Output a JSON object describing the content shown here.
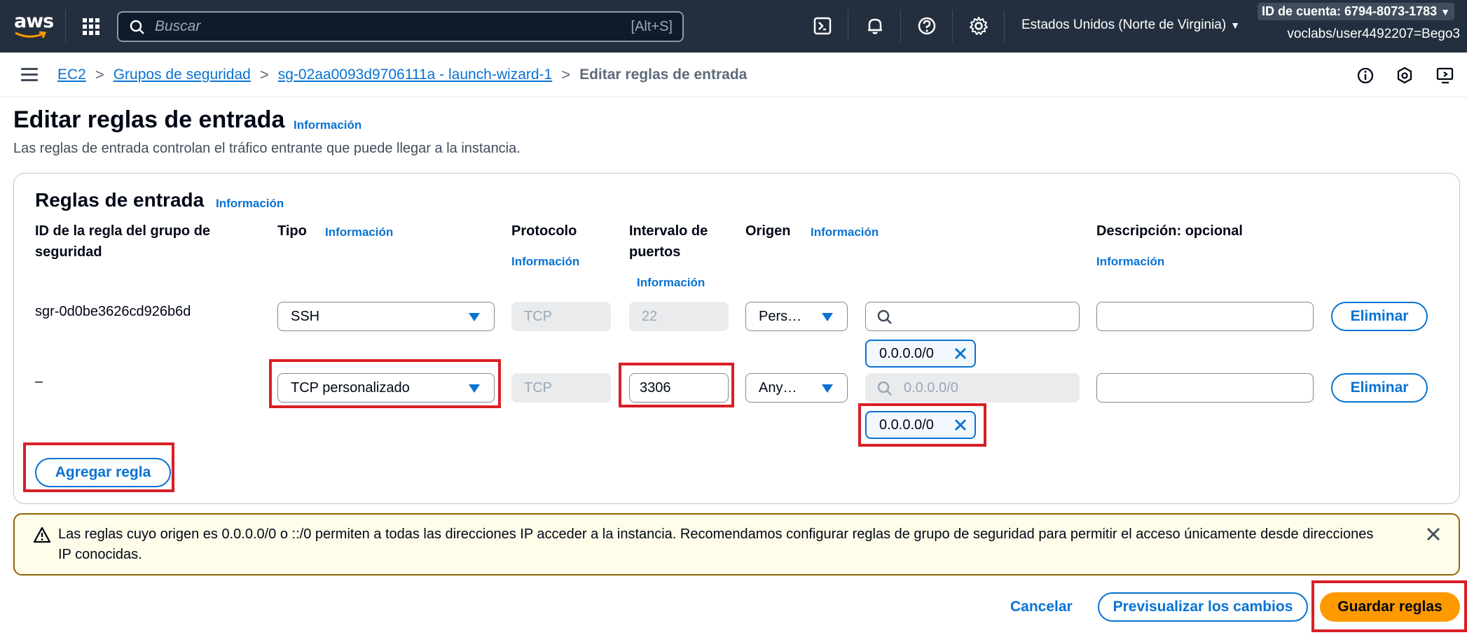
{
  "topnav": {
    "logo_text": "aws",
    "search_placeholder": "Buscar",
    "search_shortcut": "[Alt+S]",
    "region": "Estados Unidos (Norte de Virginia)",
    "account_id": "ID de cuenta: 6794-8073-1783",
    "user": "voclabs/user4492207=Bego3",
    "icons": [
      "cloudshell-icon",
      "bell-icon",
      "help-icon",
      "gear-icon"
    ]
  },
  "breadcrumb": {
    "items": [
      "EC2",
      "Grupos de seguridad",
      "sg-02aa0093d9706111a - launch-wizard-1"
    ],
    "current": "Editar reglas de entrada"
  },
  "header": {
    "title": "Editar reglas de entrada",
    "info": "Información",
    "description": "Las reglas de entrada controlan el tráfico entrante que puede llegar a la instancia."
  },
  "rules": {
    "title": "Reglas de entrada",
    "info": "Información",
    "columns": {
      "rule_id": "ID de la regla del grupo de seguridad",
      "type": "Tipo",
      "protocol": "Protocolo",
      "port_range": "Intervalo de puertos",
      "source": "Origen",
      "description": "Descripción: opcional"
    },
    "rows": [
      {
        "id": "sgr-0d0be3626cd926b6d",
        "type": "SSH",
        "protocol": "TCP",
        "port": "22",
        "source_type": "Pers…",
        "cidr_placeholder": "",
        "token": "0.0.0.0/0",
        "description": "",
        "remove_label": "Eliminar"
      },
      {
        "id": "–",
        "type": "TCP personalizado",
        "protocol": "TCP",
        "port": "3306",
        "source_type": "Any…",
        "cidr_placeholder": "0.0.0.0/0",
        "token": "0.0.0.0/0",
        "description": "",
        "remove_label": "Eliminar"
      }
    ],
    "add_rule_label": "Agregar regla"
  },
  "warning": {
    "message": "Las reglas cuyo origen es 0.0.0.0/0 o ::/0 permiten a todas las direcciones IP acceder a la instancia. Recomendamos configurar reglas de grupo de seguridad para permitir el acceso únicamente desde direcciones IP conocidas."
  },
  "footer": {
    "cancel_label": "Cancelar",
    "preview_label": "Previsualizar los cambios",
    "save_label": "Guardar reglas"
  },
  "colors": {
    "nav_bg": "#232f3e",
    "link": "#0972d3",
    "primary": "#ff9900",
    "highlight": "#d91f26",
    "warning_border": "#8d6605"
  }
}
